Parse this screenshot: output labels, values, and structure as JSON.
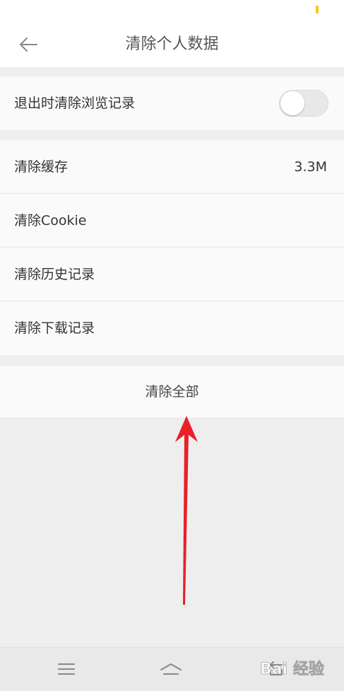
{
  "header": {
    "title": "清除个人数据",
    "back_icon": "arrow-left-icon"
  },
  "settings": {
    "clear_on_exit": {
      "label": "退出时清除浏览记录",
      "enabled": false
    }
  },
  "items": [
    {
      "label": "清除缓存",
      "value": "3.3M"
    },
    {
      "label": "清除Cookie"
    },
    {
      "label": "清除历史记录"
    },
    {
      "label": "清除下载记录"
    }
  ],
  "clear_all_label": "清除全部",
  "nav": {
    "menu_icon": "menu-icon",
    "home_icon": "home-icon",
    "back_icon": "back-icon"
  },
  "watermark_text": "Bai 经验",
  "colors": {
    "annotation_arrow": "#e8202a",
    "battery": "#f5c518"
  }
}
